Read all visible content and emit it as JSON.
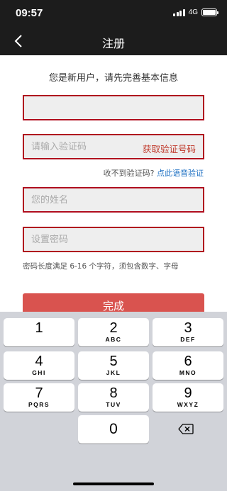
{
  "status_bar": {
    "time": "09:57",
    "network": "4G"
  },
  "nav": {
    "title": "注册"
  },
  "form": {
    "subtitle": "您是新用户，请先完善基本信息",
    "phone_value": "",
    "code_placeholder": "请输入验证码",
    "get_code_label": "获取验证号码",
    "voice_prompt": "收不到验证码?",
    "voice_link": "点此语音验证",
    "name_placeholder": "您的姓名",
    "password_placeholder": "设置密码",
    "password_hint": "密码长度满足 6-16 个字符，须包含数字、字母",
    "submit_label": "完成"
  },
  "keyboard": {
    "keys": [
      {
        "num": "1",
        "letters": ""
      },
      {
        "num": "2",
        "letters": "ABC"
      },
      {
        "num": "3",
        "letters": "DEF"
      },
      {
        "num": "4",
        "letters": "GHI"
      },
      {
        "num": "5",
        "letters": "JKL"
      },
      {
        "num": "6",
        "letters": "MNO"
      },
      {
        "num": "7",
        "letters": "PQRS"
      },
      {
        "num": "8",
        "letters": "TUV"
      },
      {
        "num": "9",
        "letters": "WXYZ"
      },
      {
        "num": "0",
        "letters": ""
      }
    ]
  },
  "colors": {
    "accent": "#b00d1e",
    "button": "#d9534f",
    "link": "#1a6ec2",
    "nav": "#1c1c1c"
  }
}
